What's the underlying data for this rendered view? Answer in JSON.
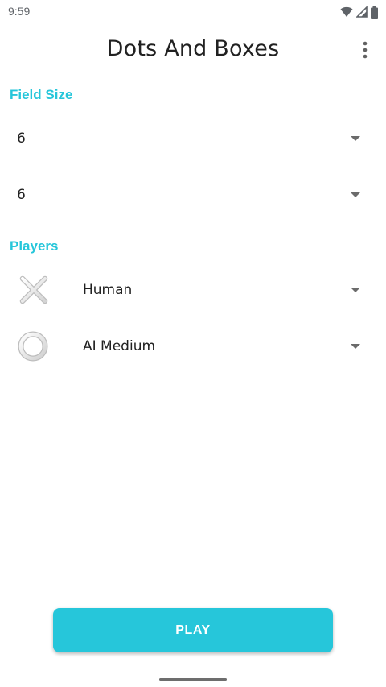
{
  "status_bar": {
    "time": "9:59",
    "icons": [
      "wifi-icon",
      "cellular-signal-icon",
      "battery-icon"
    ]
  },
  "app_bar": {
    "title": "Dots And Boxes",
    "menu_icon": "more-vert-icon"
  },
  "field_size": {
    "label": "Field Size",
    "width_value": "6",
    "height_value": "6"
  },
  "players": {
    "label": "Players",
    "list": [
      {
        "icon": "cross-icon",
        "type": "Human"
      },
      {
        "icon": "ring-icon",
        "type": "AI Medium"
      }
    ]
  },
  "play_button": {
    "label": "PLAY"
  },
  "colors": {
    "accent": "#26c6da",
    "text": "#212121",
    "background": "#ffffff"
  }
}
